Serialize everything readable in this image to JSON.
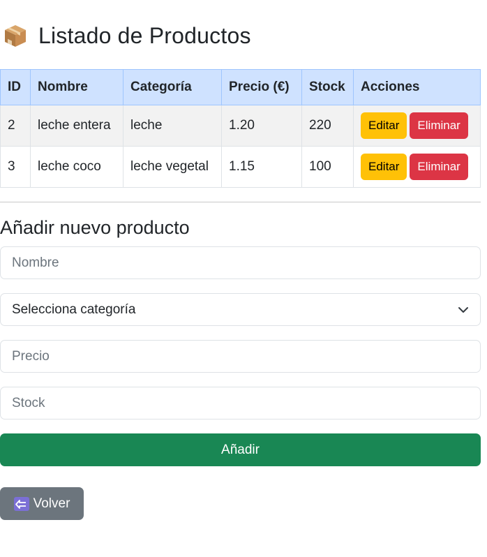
{
  "header": {
    "icon": "package-icon",
    "title": "Listado de Productos"
  },
  "table": {
    "columns": [
      "ID",
      "Nombre",
      "Categoría",
      "Precio (€)",
      "Stock",
      "Acciones"
    ],
    "rows": [
      {
        "id": "2",
        "nombre": "leche entera",
        "categoria": "leche",
        "precio": "1.20",
        "stock": "220"
      },
      {
        "id": "3",
        "nombre": "leche coco",
        "categoria": "leche vegetal",
        "precio": "1.15",
        "stock": "100"
      }
    ],
    "edit_label": "Editar",
    "delete_label": "Eliminar"
  },
  "form": {
    "title": "Añadir nuevo producto",
    "name_placeholder": "Nombre",
    "category_selected": "Selecciona categoría",
    "price_placeholder": "Precio",
    "stock_placeholder": "Stock",
    "submit_label": "Añadir"
  },
  "back": {
    "icon": "back-arrow-icon",
    "label": "Volver"
  },
  "colors": {
    "table_header": "#cfe2ff",
    "edit": "#ffc107",
    "delete": "#dc3545",
    "add": "#198754",
    "back": "#6c757d"
  }
}
